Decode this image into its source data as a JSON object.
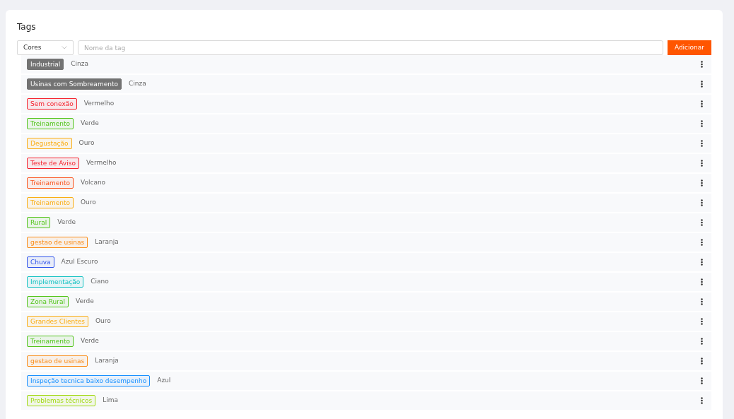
{
  "title": "Tags",
  "color_select": {
    "value": "Cores"
  },
  "name_field": {
    "placeholder": "Nome da tag"
  },
  "add_button": {
    "label": "Adicionar"
  },
  "tags": [
    {
      "label": "Industrial",
      "color_name": "Cinza",
      "kind": "solid",
      "color": "#737373"
    },
    {
      "label": "Usinas com Sombreamento",
      "color_name": "Cinza",
      "kind": "solid",
      "color": "#737373"
    },
    {
      "label": "Sem conexão",
      "color_name": "Vermelho",
      "kind": "outline",
      "color": "#f5222d"
    },
    {
      "label": "Treinamento",
      "color_name": "Verde",
      "kind": "outline",
      "color": "#52c41a"
    },
    {
      "label": "Degustação",
      "color_name": "Ouro",
      "kind": "outline",
      "color": "#faad14"
    },
    {
      "label": "Teste de Aviso",
      "color_name": "Vermelho",
      "kind": "outline",
      "color": "#f5222d"
    },
    {
      "label": "Treinamento",
      "color_name": "Volcano",
      "kind": "outline",
      "color": "#fa541c"
    },
    {
      "label": "Treinamento",
      "color_name": "Ouro",
      "kind": "outline",
      "color": "#faad14"
    },
    {
      "label": "Rural",
      "color_name": "Verde",
      "kind": "outline",
      "color": "#52c41a"
    },
    {
      "label": "gestao de usinas",
      "color_name": "Laranja",
      "kind": "outline",
      "color": "#fa8c16"
    },
    {
      "label": "Chuva",
      "color_name": "Azul Escuro",
      "kind": "outline",
      "color": "#2f54eb"
    },
    {
      "label": "Implementação",
      "color_name": "Ciano",
      "kind": "outline",
      "color": "#13c2c2"
    },
    {
      "label": "Zona Rural",
      "color_name": "Verde",
      "kind": "outline",
      "color": "#52c41a"
    },
    {
      "label": "Grandes Clientes",
      "color_name": "Ouro",
      "kind": "outline",
      "color": "#faad14"
    },
    {
      "label": "Treinamento",
      "color_name": "Verde",
      "kind": "outline",
      "color": "#52c41a"
    },
    {
      "label": "gestao de usinas",
      "color_name": "Laranja",
      "kind": "outline",
      "color": "#fa8c16"
    },
    {
      "label": "Inspeção tecnica baixo desempenho",
      "color_name": "Azul",
      "kind": "outline",
      "color": "#1890ff"
    },
    {
      "label": "Problemas técnicos",
      "color_name": "Lima",
      "kind": "outline",
      "color": "#a0d911"
    }
  ]
}
